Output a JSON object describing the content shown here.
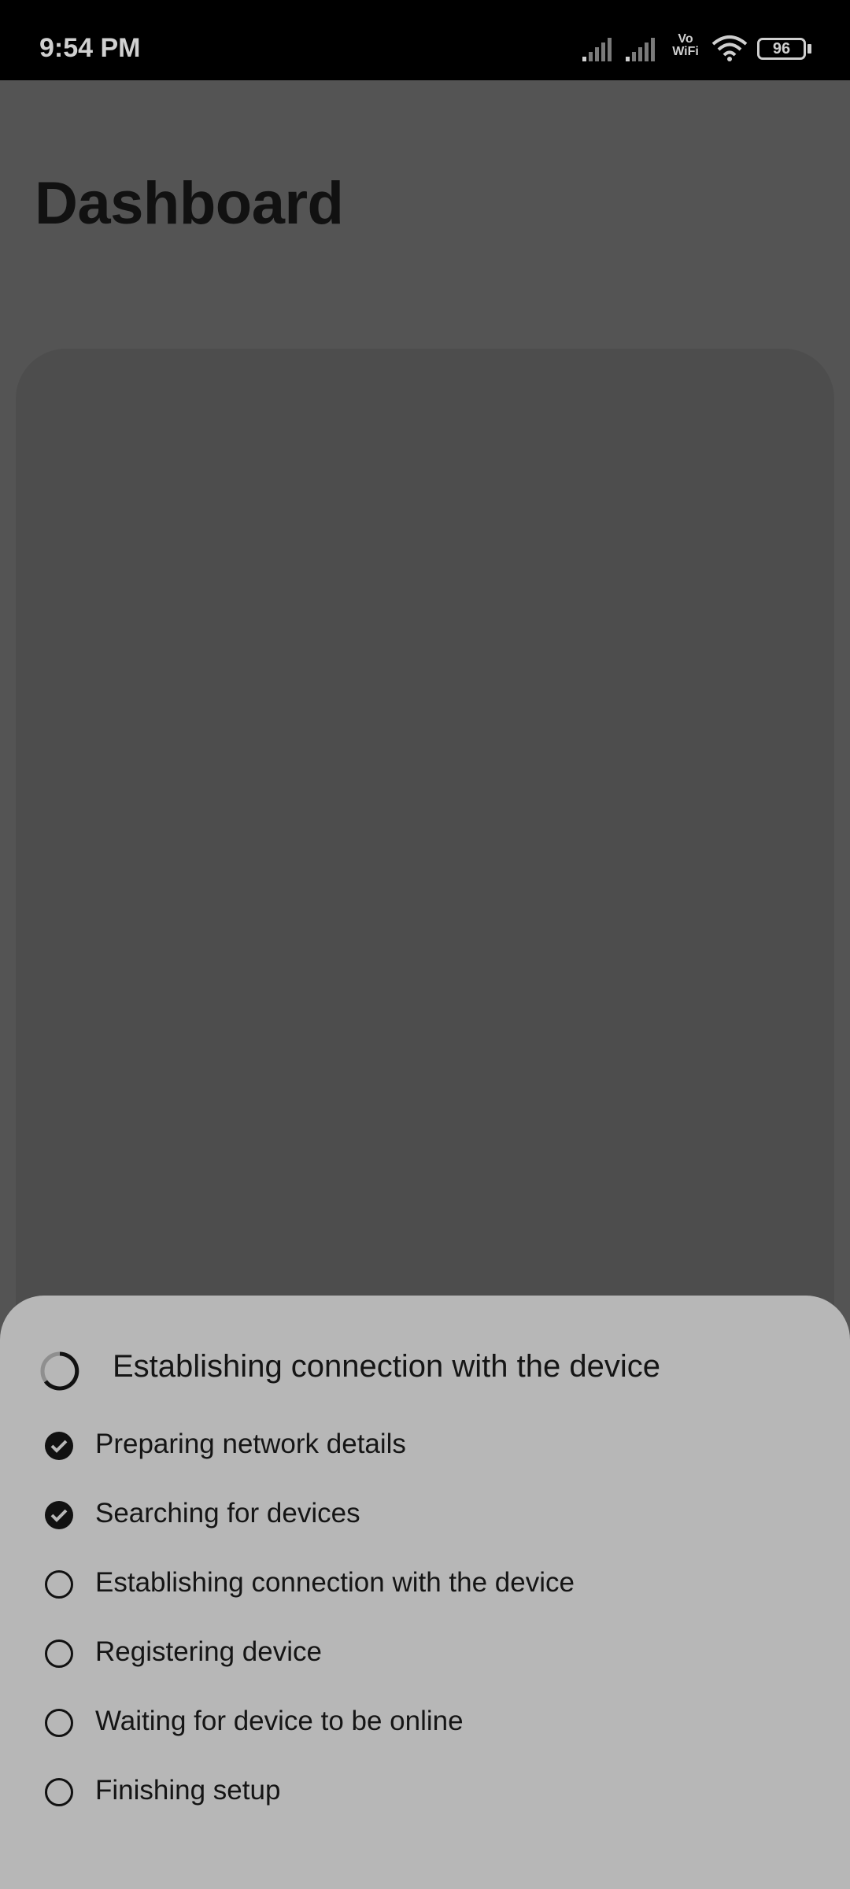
{
  "status_bar": {
    "time": "9:54 PM",
    "vowifi_line1": "Vo",
    "vowifi_line2": "WiFi",
    "battery_level": "96",
    "icons": [
      "signal-icon",
      "signal-icon",
      "vowifi-icon",
      "wifi-icon",
      "battery-icon"
    ]
  },
  "page": {
    "title": "Dashboard"
  },
  "sheet": {
    "title": "Establishing connection with the device",
    "steps": [
      {
        "label": "Preparing network details",
        "status": "done"
      },
      {
        "label": "Searching for devices",
        "status": "done"
      },
      {
        "label": "Establishing connection with the device",
        "status": "pending"
      },
      {
        "label": "Registering device",
        "status": "pending"
      },
      {
        "label": "Waiting for device to be online",
        "status": "pending"
      },
      {
        "label": "Finishing setup",
        "status": "pending"
      }
    ]
  },
  "colors": {
    "status_bar": "#000000",
    "scrim": "#545454",
    "sheet": "#b7b7b7",
    "text": "#151515"
  }
}
